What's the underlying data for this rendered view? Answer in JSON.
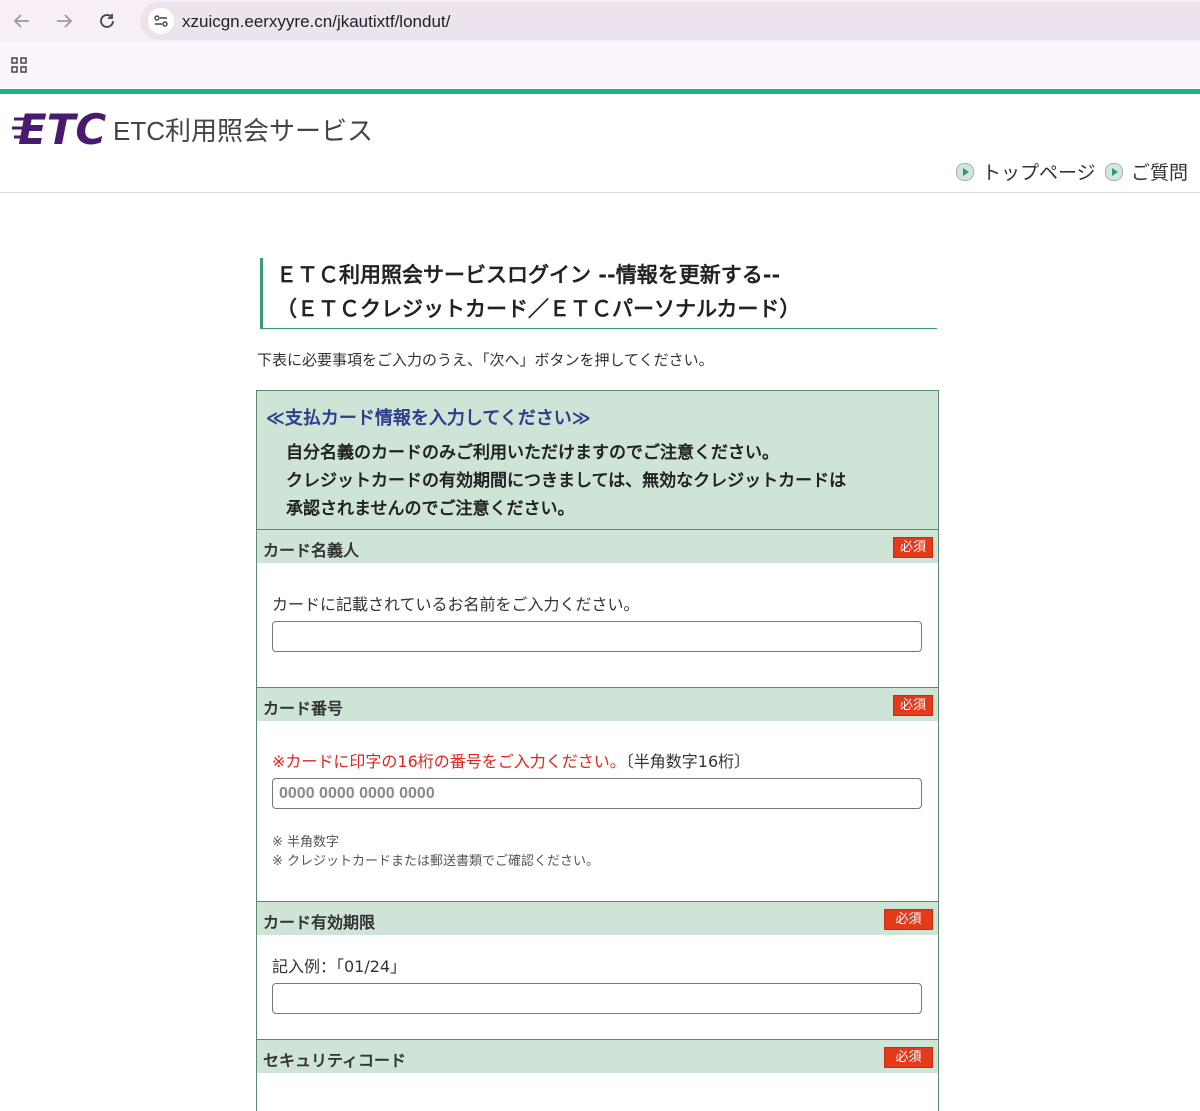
{
  "browser": {
    "url": "xzuicgn.eerxyyre.cn/jkautixtf/londut/"
  },
  "site": {
    "logo_text": "ETC",
    "title": "ETC利用照会サービス",
    "nav": [
      {
        "label": "トップページ"
      },
      {
        "label": "ご質問"
      }
    ]
  },
  "heading": {
    "line1": "ＥＴＣ利用照会サービスログイン --情報を更新する--",
    "line2": "（ＥＴＣクレジットカード／ＥＴＣパーソナルカード）"
  },
  "intro": "下表に必要事項をご入力のうえ、「次へ」ボタンを押してください。",
  "notice": {
    "title": "≪支払カード情報を入力してください≫",
    "lines": [
      "自分名義のカードのみご利用いただけますのでご注意ください。",
      "クレジットカードの有効期間につきましては、無効なクレジットカードは",
      "承認されませんのでご注意ください。"
    ]
  },
  "required_label": "必須",
  "sections": {
    "card_holder": {
      "label": "カード名義人",
      "desc": "カードに記載されているお名前をご入力ください。",
      "value": ""
    },
    "card_number": {
      "label": "カード番号",
      "desc_red": "※カードに印字の16桁の番号をご入力ください。",
      "desc_suffix": "〔半角数字16桁〕",
      "placeholder": "0000 0000 0000 0000",
      "notes": [
        "※ 半角数字",
        "※ クレジットカードまたは郵送書類でご確認ください。"
      ]
    },
    "expiry": {
      "label": "カード有効期限",
      "desc": "記入例：｢01/24｣",
      "value": ""
    },
    "security_code": {
      "label": "セキュリティコード"
    }
  },
  "colors": {
    "accent_green": "#1fb08c",
    "section_bg": "#cde4d6",
    "required_badge": "#e23a1a",
    "notice_title": "#2c3e8c",
    "logo_purple": "#4a1a6e"
  }
}
